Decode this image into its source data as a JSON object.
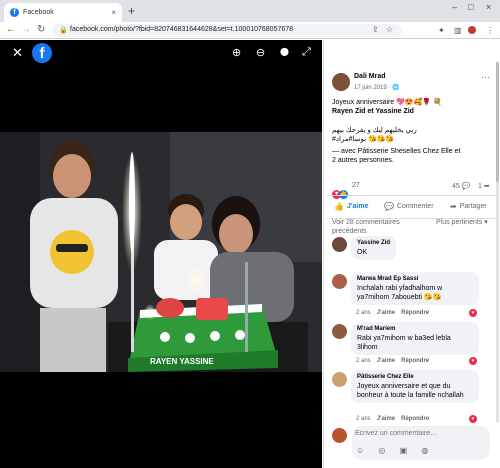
{
  "browser": {
    "tab_title": "Facebook",
    "tab_close": "×",
    "new_tab": "+",
    "url": "facebook.com/photo/?fbid=820746831644628&set=t.100010768057678",
    "win_min": "–",
    "win_max": "□",
    "win_close": "×"
  },
  "viewer": {
    "brand": "f",
    "close_glyph": "✕",
    "zoom_in_glyph": "⊕",
    "zoom_out_glyph": "⊖",
    "tag_glyph": "⬤",
    "fullscreen_glyph": "⤢",
    "cake_text": "RAYEN   YASSINE"
  },
  "header_buttons": {
    "plus": "+",
    "messenger": "✉",
    "bell": "🔔",
    "account": ""
  },
  "post": {
    "author": "Dali Mrad",
    "date": "17 juin 2019 · 🌐",
    "more": "···",
    "line1": "Joyeux anniversaire 💖😍🥰🌹 💐",
    "line2": "Rayen Zid et Yassine Zid",
    "line3": "ربي يخليهم ليك و يفرحك بيهم",
    "line4": "#نوسا#مراد 😘😘😘",
    "line5": "— avec Pâtisserie Sheselles Chez Elle et",
    "line6": "2 autres personnes.",
    "reactions_count": "27",
    "comments_count": "45 💬",
    "shares_count": "1 ➦",
    "like_label": "J'aime",
    "comment_label": "Commenter",
    "share_label": "Partager",
    "prev_comments": "Voir 28 commentaires précédents",
    "sort_label": "Plus pertinents ▾"
  },
  "comments": [
    {
      "name": "Yassine Zid",
      "text": "OK",
      "like": "",
      "reply": ""
    },
    {
      "name": "Marwa Mrad Ep Sassi",
      "text": "Inchalah rabi yfadhalhom w ya7mihom 7abouebti 😘😘",
      "age": "2 ans",
      "like": "J'aime",
      "reply": "Répondre"
    },
    {
      "name": "M'rad Mariem",
      "text": "Rabi ya7mihom w ba3ed lebla 3lihom",
      "age": "2 ans",
      "like": "J'aime",
      "reply": "Répondre"
    },
    {
      "name": "Pâtisserie Chez Elle",
      "text": "Joyeux anniversaire et que du bonheur à toute la famille nchallah",
      "age": "2 ans",
      "like": "J'aime",
      "reply": "Répondre"
    }
  ],
  "composer": {
    "placeholder": "Écrivez un commentaire…",
    "icons": "☺ ◎ ▣ ◍"
  },
  "colors": {
    "fb_blue": "#1877f2",
    "like_red": "#f02849"
  }
}
